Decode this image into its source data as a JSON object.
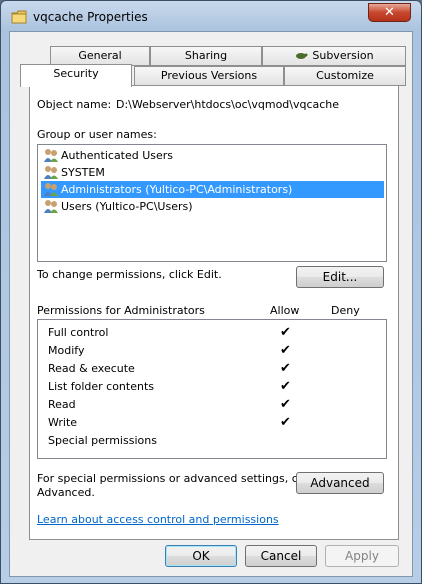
{
  "window": {
    "title": "vqcache Properties",
    "close_glyph": "✕"
  },
  "tabs_row1": [
    "General",
    "Sharing",
    "Subversion"
  ],
  "tabs_row2": [
    "Security",
    "Previous Versions",
    "Customize"
  ],
  "security": {
    "object_name_label": "Object name:",
    "object_name_value": "D:\\Webserver\\htdocs\\oc\\vqmod\\vqcache",
    "group_label": "Group or user names:",
    "users": [
      "Authenticated Users",
      "SYSTEM",
      "Administrators (Yultico-PC\\Administrators)",
      "Users (Yultico-PC\\Users)"
    ],
    "selected_user_index": 2,
    "change_text": "To change permissions, click Edit.",
    "edit_button": "Edit...",
    "permissions_for": "Permissions for Administrators",
    "allow_header": "Allow",
    "deny_header": "Deny",
    "permissions": [
      {
        "name": "Full control",
        "allow": true,
        "deny": false
      },
      {
        "name": "Modify",
        "allow": true,
        "deny": false
      },
      {
        "name": "Read & execute",
        "allow": true,
        "deny": false
      },
      {
        "name": "List folder contents",
        "allow": true,
        "deny": false
      },
      {
        "name": "Read",
        "allow": true,
        "deny": false
      },
      {
        "name": "Write",
        "allow": true,
        "deny": false
      },
      {
        "name": "Special permissions",
        "allow": false,
        "deny": false
      }
    ],
    "check_glyph": "✔",
    "advanced_text_line1": "For special permissions or advanced settings, click",
    "advanced_text_line2": "Advanced.",
    "advanced_button": "Advanced",
    "learn_link": "Learn about access control and permissions"
  },
  "footer": {
    "ok": "OK",
    "cancel": "Cancel",
    "apply": "Apply"
  },
  "colors": {
    "selection": "#3399ff",
    "link": "#0066cc"
  }
}
